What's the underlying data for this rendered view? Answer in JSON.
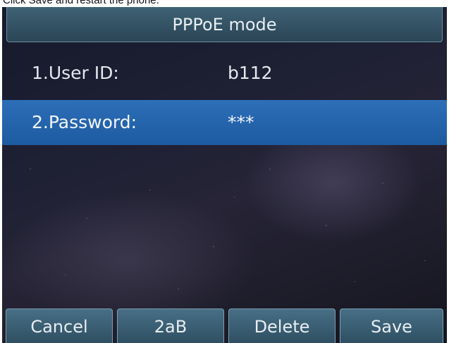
{
  "caption": "Click Save and restart the phone.",
  "screen": {
    "title": "PPPoE mode",
    "rows": [
      {
        "label": "1.User ID:",
        "value": "b112"
      },
      {
        "label": "2.Password:",
        "value": "***"
      }
    ],
    "selected_row": 2
  },
  "softkeys": [
    "Cancel",
    "2aB",
    "Delete",
    "Save"
  ],
  "colors": {
    "title_bar": "#355466",
    "selected_row": "#2563aa",
    "softkey": "#3c5f73",
    "background": "#1e2034"
  }
}
